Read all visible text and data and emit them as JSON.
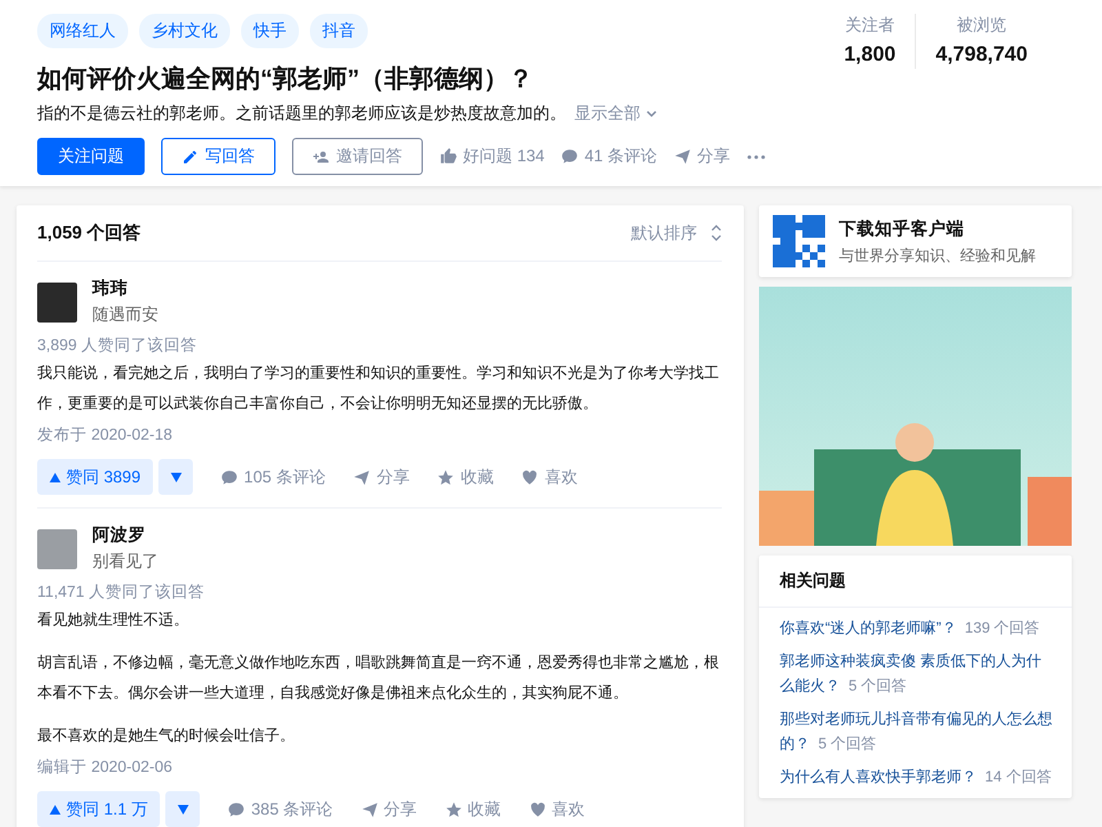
{
  "topics": [
    "网络红人",
    "乡村文化",
    "快手",
    "抖音"
  ],
  "stats": [
    {
      "label": "关注者",
      "value": "1,800"
    },
    {
      "label": "被浏览",
      "value": "4,798,740"
    }
  ],
  "question": {
    "title": "如何评价火遍全网的“郭老师”（非郭德纲）？",
    "excerpt": "指的不是德云社的郭老师。之前话题里的郭老师应该是炒热度故意加的。",
    "show_all": "显示全部"
  },
  "actions": {
    "follow": "关注问题",
    "write": "写回答",
    "invite": "邀请回答",
    "good": "好问题 134",
    "comments": "41 条评论",
    "share": "分享"
  },
  "answers_header": {
    "count": "1,059 个回答",
    "sort": "默认排序"
  },
  "answers": [
    {
      "author": "玮玮",
      "bio": "随遇而安",
      "votes_text": "3,899 人赞同了该回答",
      "paragraphs": [
        "我只能说，看完她之后，我明白了学习的重要性和知识的重要性。学习和知识不光是为了你考大学找工作，更重要的是可以武装你自己丰富你自己，不会让你明明无知还显摆的无比骄傲。"
      ],
      "date": "发布于 2020-02-18",
      "vote": "赞同 3899",
      "comments": "105 条评论",
      "share": "分享",
      "collect": "收藏",
      "like": "喜欢"
    },
    {
      "author": "阿波罗",
      "bio": "别看见了",
      "votes_text": "11,471 人赞同了该回答",
      "paragraphs": [
        "看见她就生理性不适。",
        "胡言乱语，不修边幅，毫无意义做作地吃东西，唱歌跳舞简直是一窍不通，恩爱秀得也非常之尴尬，根本看不下去。偶尔会讲一些大道理，自我感觉好像是佛祖来点化众生的，其实狗屁不通。",
        "最不喜欢的是她生气的时候会吐信子。"
      ],
      "date": "编辑于 2020-02-06",
      "vote": "赞同 1.1 万",
      "comments": "385 条评论",
      "share": "分享",
      "collect": "收藏",
      "like": "喜欢"
    }
  ],
  "sidebar": {
    "download": {
      "title": "下载知乎客户端",
      "subtitle": "与世界分享知识、经验和见解"
    },
    "related": {
      "title": "相关问题",
      "items": [
        {
          "question": "你喜欢“迷人的郭老师嘛”？",
          "count": "139 个回答"
        },
        {
          "question": "郭老师这种装疯卖傻 素质低下的人为什么能火？",
          "count": "5 个回答"
        },
        {
          "question": "那些对老师玩儿抖音带有偏见的人怎么想的？",
          "count": "5 个回答"
        },
        {
          "question": "为什么有人喜欢快手郭老师？",
          "count": "14 个回答"
        }
      ]
    }
  }
}
